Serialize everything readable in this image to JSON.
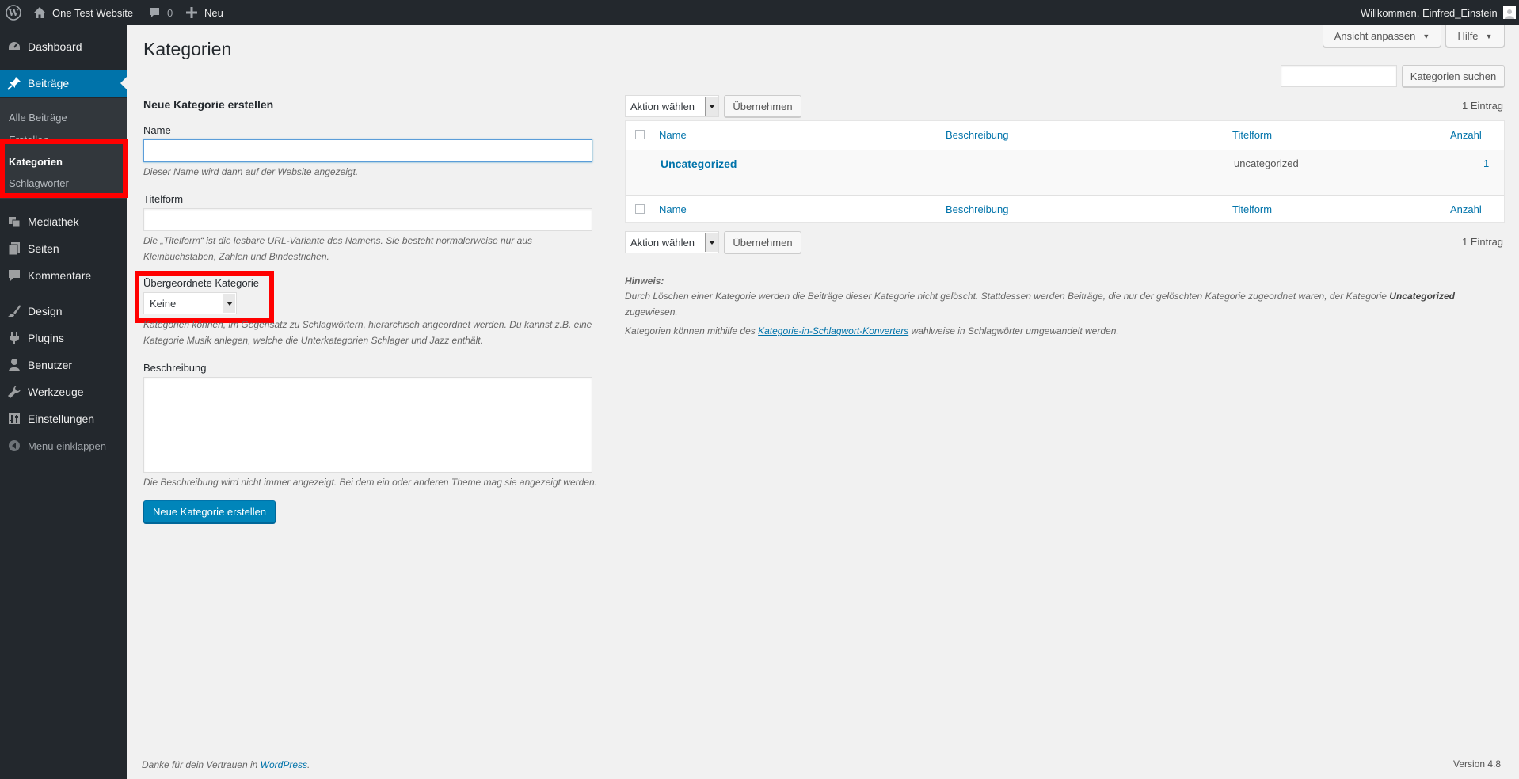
{
  "adminbar": {
    "site_name": "One Test Website",
    "comments_count": "0",
    "new_label": "Neu",
    "welcome": "Willkommen, Einfred_Einstein"
  },
  "sidebar": {
    "items": [
      {
        "label": "Dashboard",
        "icon": "dashboard-icon"
      },
      {
        "label": "Beiträge",
        "icon": "pin-icon"
      },
      {
        "label": "Mediathek",
        "icon": "media-icon"
      },
      {
        "label": "Seiten",
        "icon": "pages-icon"
      },
      {
        "label": "Kommentare",
        "icon": "comment-icon"
      },
      {
        "label": "Design",
        "icon": "brush-icon"
      },
      {
        "label": "Plugins",
        "icon": "plugin-icon"
      },
      {
        "label": "Benutzer",
        "icon": "user-icon"
      },
      {
        "label": "Werkzeuge",
        "icon": "wrench-icon"
      },
      {
        "label": "Einstellungen",
        "icon": "settings-icon"
      },
      {
        "label": "Menü einklappen",
        "icon": "collapse-icon"
      }
    ],
    "submenu": [
      "Alle Beiträge",
      "Erstellen",
      "Kategorien",
      "Schlagwörter"
    ]
  },
  "screen_options": "Ansicht anpassen",
  "help": "Hilfe",
  "page_title": "Kategorien",
  "search": {
    "button": "Kategorien suchen",
    "value": ""
  },
  "form": {
    "title": "Neue Kategorie erstellen",
    "name_label": "Name",
    "name_desc": "Dieser Name wird dann auf der Website angezeigt.",
    "slug_label": "Titelform",
    "slug_desc_1": "Die „Titelform“ ist die lesbare URL-Variante des Namens. Sie besteht normalerweise nur aus",
    "slug_desc_2": "Kleinbuchstaben, Zahlen und Bindestrichen.",
    "parent_label": "Übergeordnete Kategorie",
    "parent_value": "Keine",
    "parent_desc_1": "Kategorien können, im Gegensatz zu Schlagwörtern, hierarchisch angeordnet werden. Du kannst z.B. eine",
    "parent_desc_2": "Kategorie Musik anlegen, welche die Unterkategorien Schlager und Jazz enthält.",
    "desc_label": "Beschreibung",
    "desc_desc": "Die Beschreibung wird nicht immer angezeigt. Bei dem ein oder anderen Theme mag sie angezeigt werden.",
    "submit": "Neue Kategorie erstellen"
  },
  "bulk": {
    "select": "Aktion wählen",
    "apply": "Übernehmen",
    "count": "1 Eintrag"
  },
  "table": {
    "columns": [
      "Name",
      "Beschreibung",
      "Titelform",
      "Anzahl"
    ],
    "rows": [
      {
        "name": "Uncategorized",
        "description": "",
        "slug": "uncategorized",
        "count": "1"
      }
    ]
  },
  "note": {
    "title": "Hinweis:",
    "line1": "Durch Löschen einer Kategorie werden die Beiträge dieser Kategorie nicht gelöscht. Stattdessen werden Beiträge, die nur der gelöschten Kategorie zugeordnet waren, der Kategorie",
    "line1_bold": "Uncategorized",
    "line2": "zugewiesen.",
    "line3_pre": "Kategorien können mithilfe des",
    "line3_link": "Kategorie-in-Schlagwort-Konverters",
    "line3_post": "wahlweise in Schlagwörter umgewandelt werden."
  },
  "footer": {
    "thanks": "Danke für dein Vertrauen in",
    "link": "WordPress",
    "version": "Version 4.8"
  },
  "colors": {
    "accent": "#0073aa",
    "adminbar": "#23282d",
    "highlight": "#ff0000"
  }
}
